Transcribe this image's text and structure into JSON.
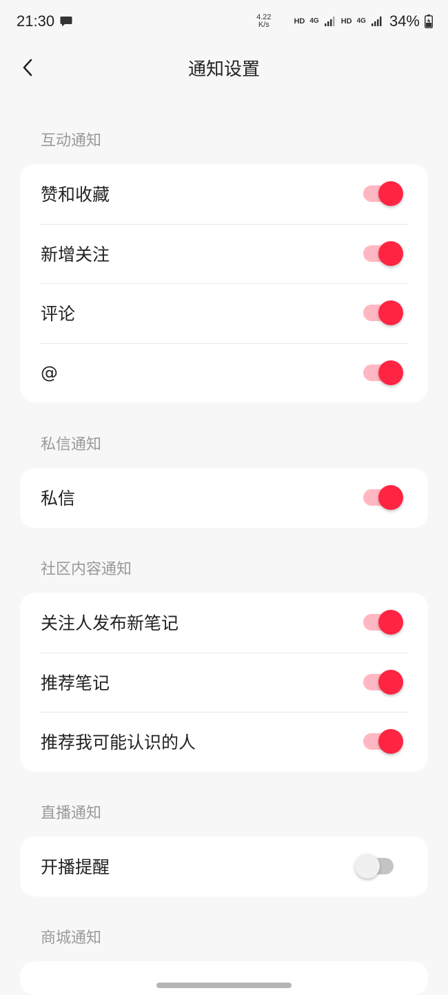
{
  "status_bar": {
    "time": "21:30",
    "net_speed_value": "4.22",
    "net_speed_unit": "K/s",
    "hd1": "HD",
    "net1": "4G",
    "hd2": "HD",
    "net2": "4G",
    "battery": "34%"
  },
  "header": {
    "title": "通知设置"
  },
  "sections": [
    {
      "title": "互动通知",
      "items": [
        {
          "label": "赞和收藏",
          "on": true
        },
        {
          "label": "新增关注",
          "on": true
        },
        {
          "label": "评论",
          "on": true
        },
        {
          "label": "@",
          "on": true
        }
      ]
    },
    {
      "title": "私信通知",
      "items": [
        {
          "label": "私信",
          "on": true
        }
      ]
    },
    {
      "title": "社区内容通知",
      "items": [
        {
          "label": "关注人发布新笔记",
          "on": true
        },
        {
          "label": "推荐笔记",
          "on": true
        },
        {
          "label": "推荐我可能认识的人",
          "on": true
        }
      ]
    },
    {
      "title": "直播通知",
      "items": [
        {
          "label": "开播提醒",
          "on": false
        }
      ]
    },
    {
      "title": "商城通知",
      "items": []
    }
  ],
  "colors": {
    "accent": "#ff2442",
    "accent_track": "#ffb8c2",
    "off_track": "#c4c4c4"
  }
}
